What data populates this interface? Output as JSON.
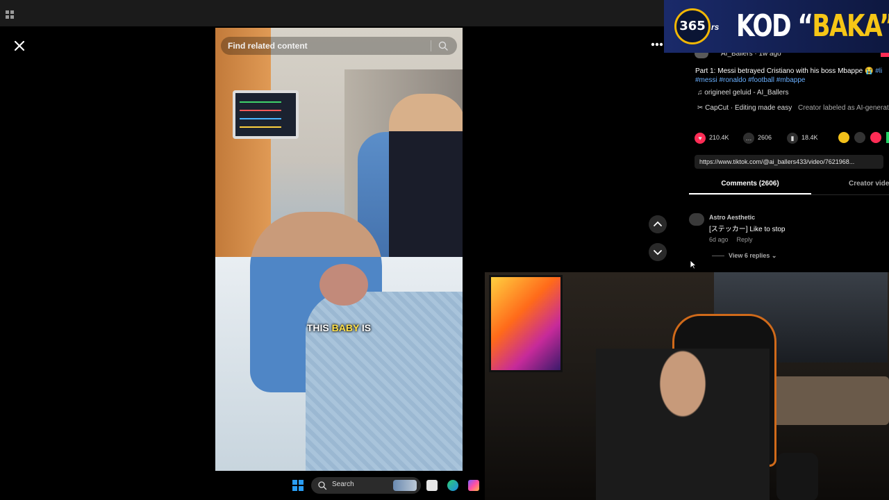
{
  "search": {
    "placeholder": "Find related content"
  },
  "video": {
    "caption_part1": "THIS ",
    "caption_highlight": "BABY",
    "caption_part2": " IS"
  },
  "panel": {
    "author": "AI_Ballers · 1w ago",
    "description_text": "Part 1: Messi betrayed Cristiano with his boss Mbappe 😭 ",
    "hashtags": [
      "#li",
      "#messi",
      "#ronaldo",
      "#football",
      "#mbappe"
    ],
    "sound": "origineel geluid - AI_Ballers",
    "capcut": "CapCut · Editing made easy",
    "ai_label": "Creator labeled as AI-generat",
    "likes": "210.4K",
    "comments_count": "2606",
    "saves": "18.4K",
    "link": "https://www.tiktok.com/@ai_ballers433/video/7621968...",
    "tab_comments": "Comments (2606)",
    "tab_creator": "Creator vide"
  },
  "comment": {
    "author": "Astro Aesthetic",
    "text": "[ステッカー] Like to stop",
    "time": "6d ago",
    "reply": "Reply",
    "view_replies": "View 6 replies"
  },
  "banner": {
    "badge": "365",
    "rs": "rs",
    "text_prefix": "KOD “",
    "text_highlight": "BAKA",
    "text_suffix": "”"
  },
  "taskbar": {
    "search_label": "Search"
  },
  "colors": {
    "accent_red": "#fe2c55",
    "link_blue": "#6ab0ff",
    "banner_gold": "#f6c616",
    "windows_blue": "#2a9df4"
  },
  "icons": [
    "apps-icon",
    "close-icon",
    "more-icon",
    "search-icon",
    "music-note-icon",
    "capcut-icon",
    "heart-icon",
    "comment-icon",
    "bookmark-icon",
    "chevron-up-icon",
    "chevron-down-icon",
    "cursor-icon",
    "windows-logo-icon",
    "edge-icon",
    "copilot-icon"
  ]
}
